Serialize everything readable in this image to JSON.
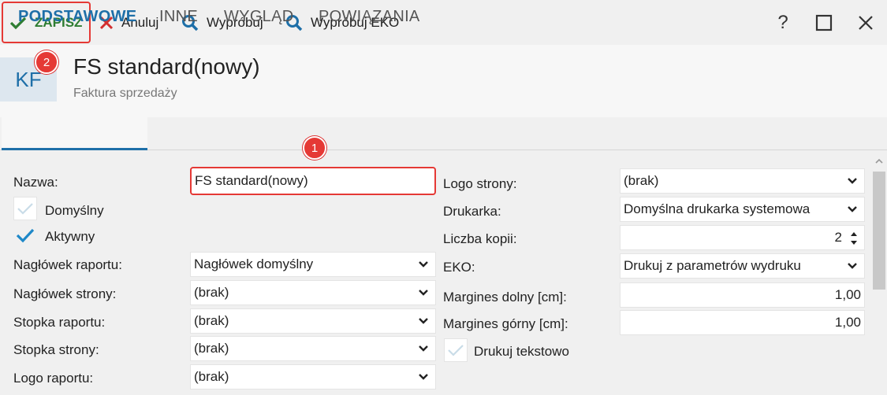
{
  "toolbar": {
    "save_label": "ZAPISZ",
    "cancel_label": "Anuluj",
    "try_label": "Wypróbuj",
    "try_eko_label": "Wypróbuj EKO"
  },
  "window": {
    "help_label": "?"
  },
  "header": {
    "icon_text": "KF",
    "title": "FS standard(nowy)",
    "subtitle": "Faktura sprzedaży"
  },
  "annotations": {
    "badge1": "1",
    "badge2": "2"
  },
  "tabs": [
    {
      "label": "PODSTAWOWE",
      "active": true
    },
    {
      "label": "INNE"
    },
    {
      "label": "WYGLĄD"
    },
    {
      "label": "POWIĄZANIA"
    }
  ],
  "form_left": {
    "name_label": "Nazwa:",
    "name_value": "FS standard(nowy)",
    "default_label": "Domyślny",
    "default_checked": false,
    "active_label": "Aktywny",
    "active_checked": true,
    "report_header_label": "Nagłówek raportu:",
    "report_header_value": "Nagłówek domyślny",
    "page_header_label": "Nagłówek strony:",
    "page_header_value": "(brak)",
    "report_footer_label": "Stopka raportu:",
    "report_footer_value": "(brak)",
    "page_footer_label": "Stopka strony:",
    "page_footer_value": "(brak)",
    "report_logo_label": "Logo raportu:",
    "report_logo_value": "(brak)"
  },
  "form_right": {
    "page_logo_label": "Logo strony:",
    "page_logo_value": "(brak)",
    "printer_label": "Drukarka:",
    "printer_value": "Domyślna drukarka systemowa",
    "copies_label": "Liczba kopii:",
    "copies_value": "2",
    "eko_label": "EKO:",
    "eko_value": "Drukuj z parametrów wydruku",
    "margin_bottom_label": "Margines dolny [cm]:",
    "margin_bottom_value": "1,00",
    "margin_top_label": "Margines górny [cm]:",
    "margin_top_value": "1,00",
    "text_print_label": "Drukuj tekstowo",
    "text_print_checked": false
  },
  "colors": {
    "accent": "#1e6fa8",
    "save_green": "#2e7d32",
    "highlight_red": "#e53935",
    "cancel_red": "#d32f2f"
  }
}
